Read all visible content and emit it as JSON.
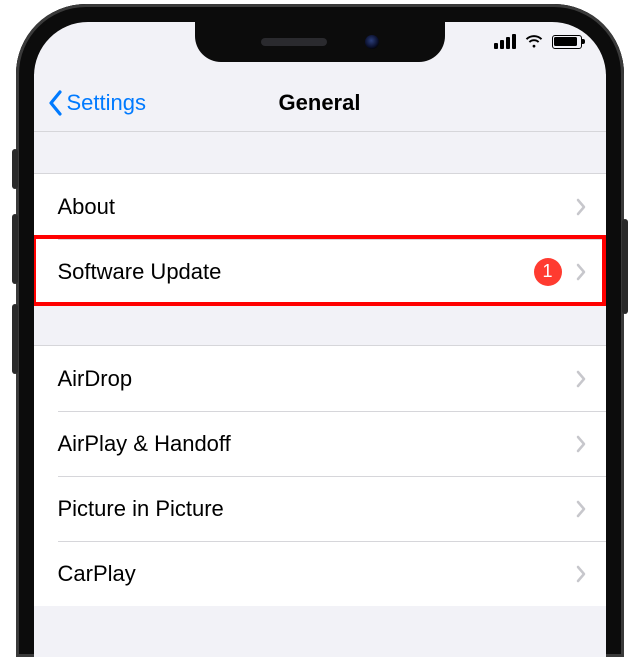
{
  "navbar": {
    "back_label": "Settings",
    "title": "General"
  },
  "groups": [
    {
      "rows": [
        {
          "label": "About",
          "badge": null
        },
        {
          "label": "Software Update",
          "badge": "1",
          "highlighted": true
        }
      ]
    },
    {
      "rows": [
        {
          "label": "AirDrop",
          "badge": null
        },
        {
          "label": "AirPlay & Handoff",
          "badge": null
        },
        {
          "label": "Picture in Picture",
          "badge": null
        },
        {
          "label": "CarPlay",
          "badge": null
        }
      ]
    }
  ]
}
